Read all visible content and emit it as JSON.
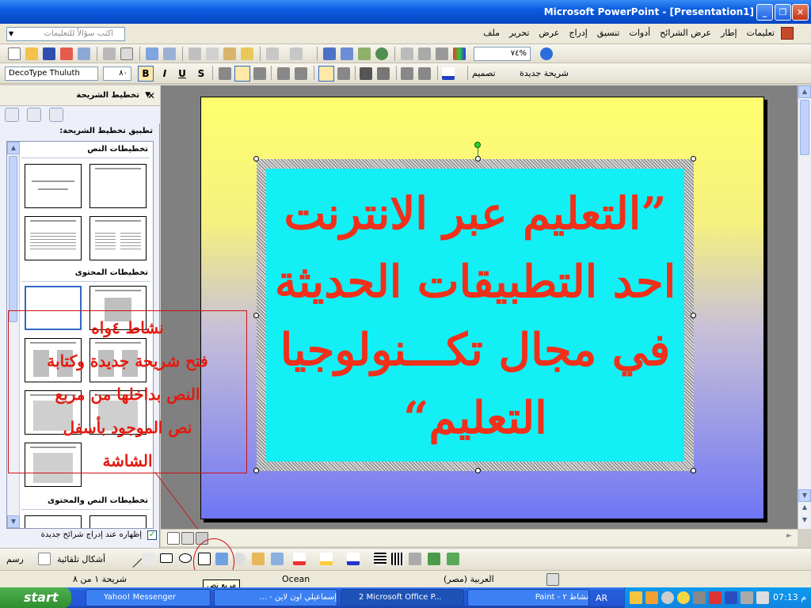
{
  "window": {
    "title": "Microsoft PowerPoint - [Presentation1]",
    "btn_min": "_",
    "btn_max": "❐",
    "btn_close": "✕"
  },
  "menubar": {
    "ask_placeholder": "اكتب سؤالاً للتعليمات",
    "items": [
      "ملف",
      "تحرير",
      "عرض",
      "إدراج",
      "تنسيق",
      "أدوات",
      "عرض الشرائح",
      "إطار",
      "تعليمات"
    ]
  },
  "toolbar": {
    "zoom": "%٧٤",
    "font": "DecoType Thuluth",
    "size": "٨٠",
    "bold": "B",
    "italic": "I",
    "underline": "U",
    "shadow": "S",
    "design_label": "تصميم",
    "new_slide_label": "شريحة جديدة"
  },
  "taskpane": {
    "title": "تخطيط الشريحة",
    "apply_label": "تطبيق تخطيط الشريحة:",
    "sections": [
      "تخطيطات النص",
      "تخطيطات المحتوى",
      "تخطيطات النص والمحتوى"
    ],
    "show_on_insert": "إظهاره عند إدراج شرائح جديدة"
  },
  "slide": {
    "lines": [
      "”التعليم عبر الانترنت",
      "احد التطبيقات الحديثة",
      "في مجال تكـــنولوجيا",
      "التعليم“"
    ],
    "text_color": "#f0301a",
    "box_color": "#12f0f5"
  },
  "annotation": {
    "lines": [
      "نشاط ٤واه",
      "فتح شريحة جديدة وكتابة",
      "النص بداخلها من مربع",
      "نص الموجود بأسفل",
      "الشاشة"
    ],
    "color": "#e31a0f"
  },
  "drawbar": {
    "draw_label": "رسم",
    "autoshapes_label": "أشكال تلقائية"
  },
  "status": {
    "slide_pos": "شريحة ١ من ٨",
    "design": "Ocean",
    "language": "العربية (مصر)",
    "tooltip": "مربع نص"
  },
  "taskbar": {
    "start": "start",
    "tasks": [
      "Yahoo! Messenger",
      "إسماعيلي اون لاين - ...",
      "2 Microsoft Office P...",
      "نشاط ٢ - Paint"
    ],
    "lang": "AR",
    "clock": "07:13 م"
  }
}
